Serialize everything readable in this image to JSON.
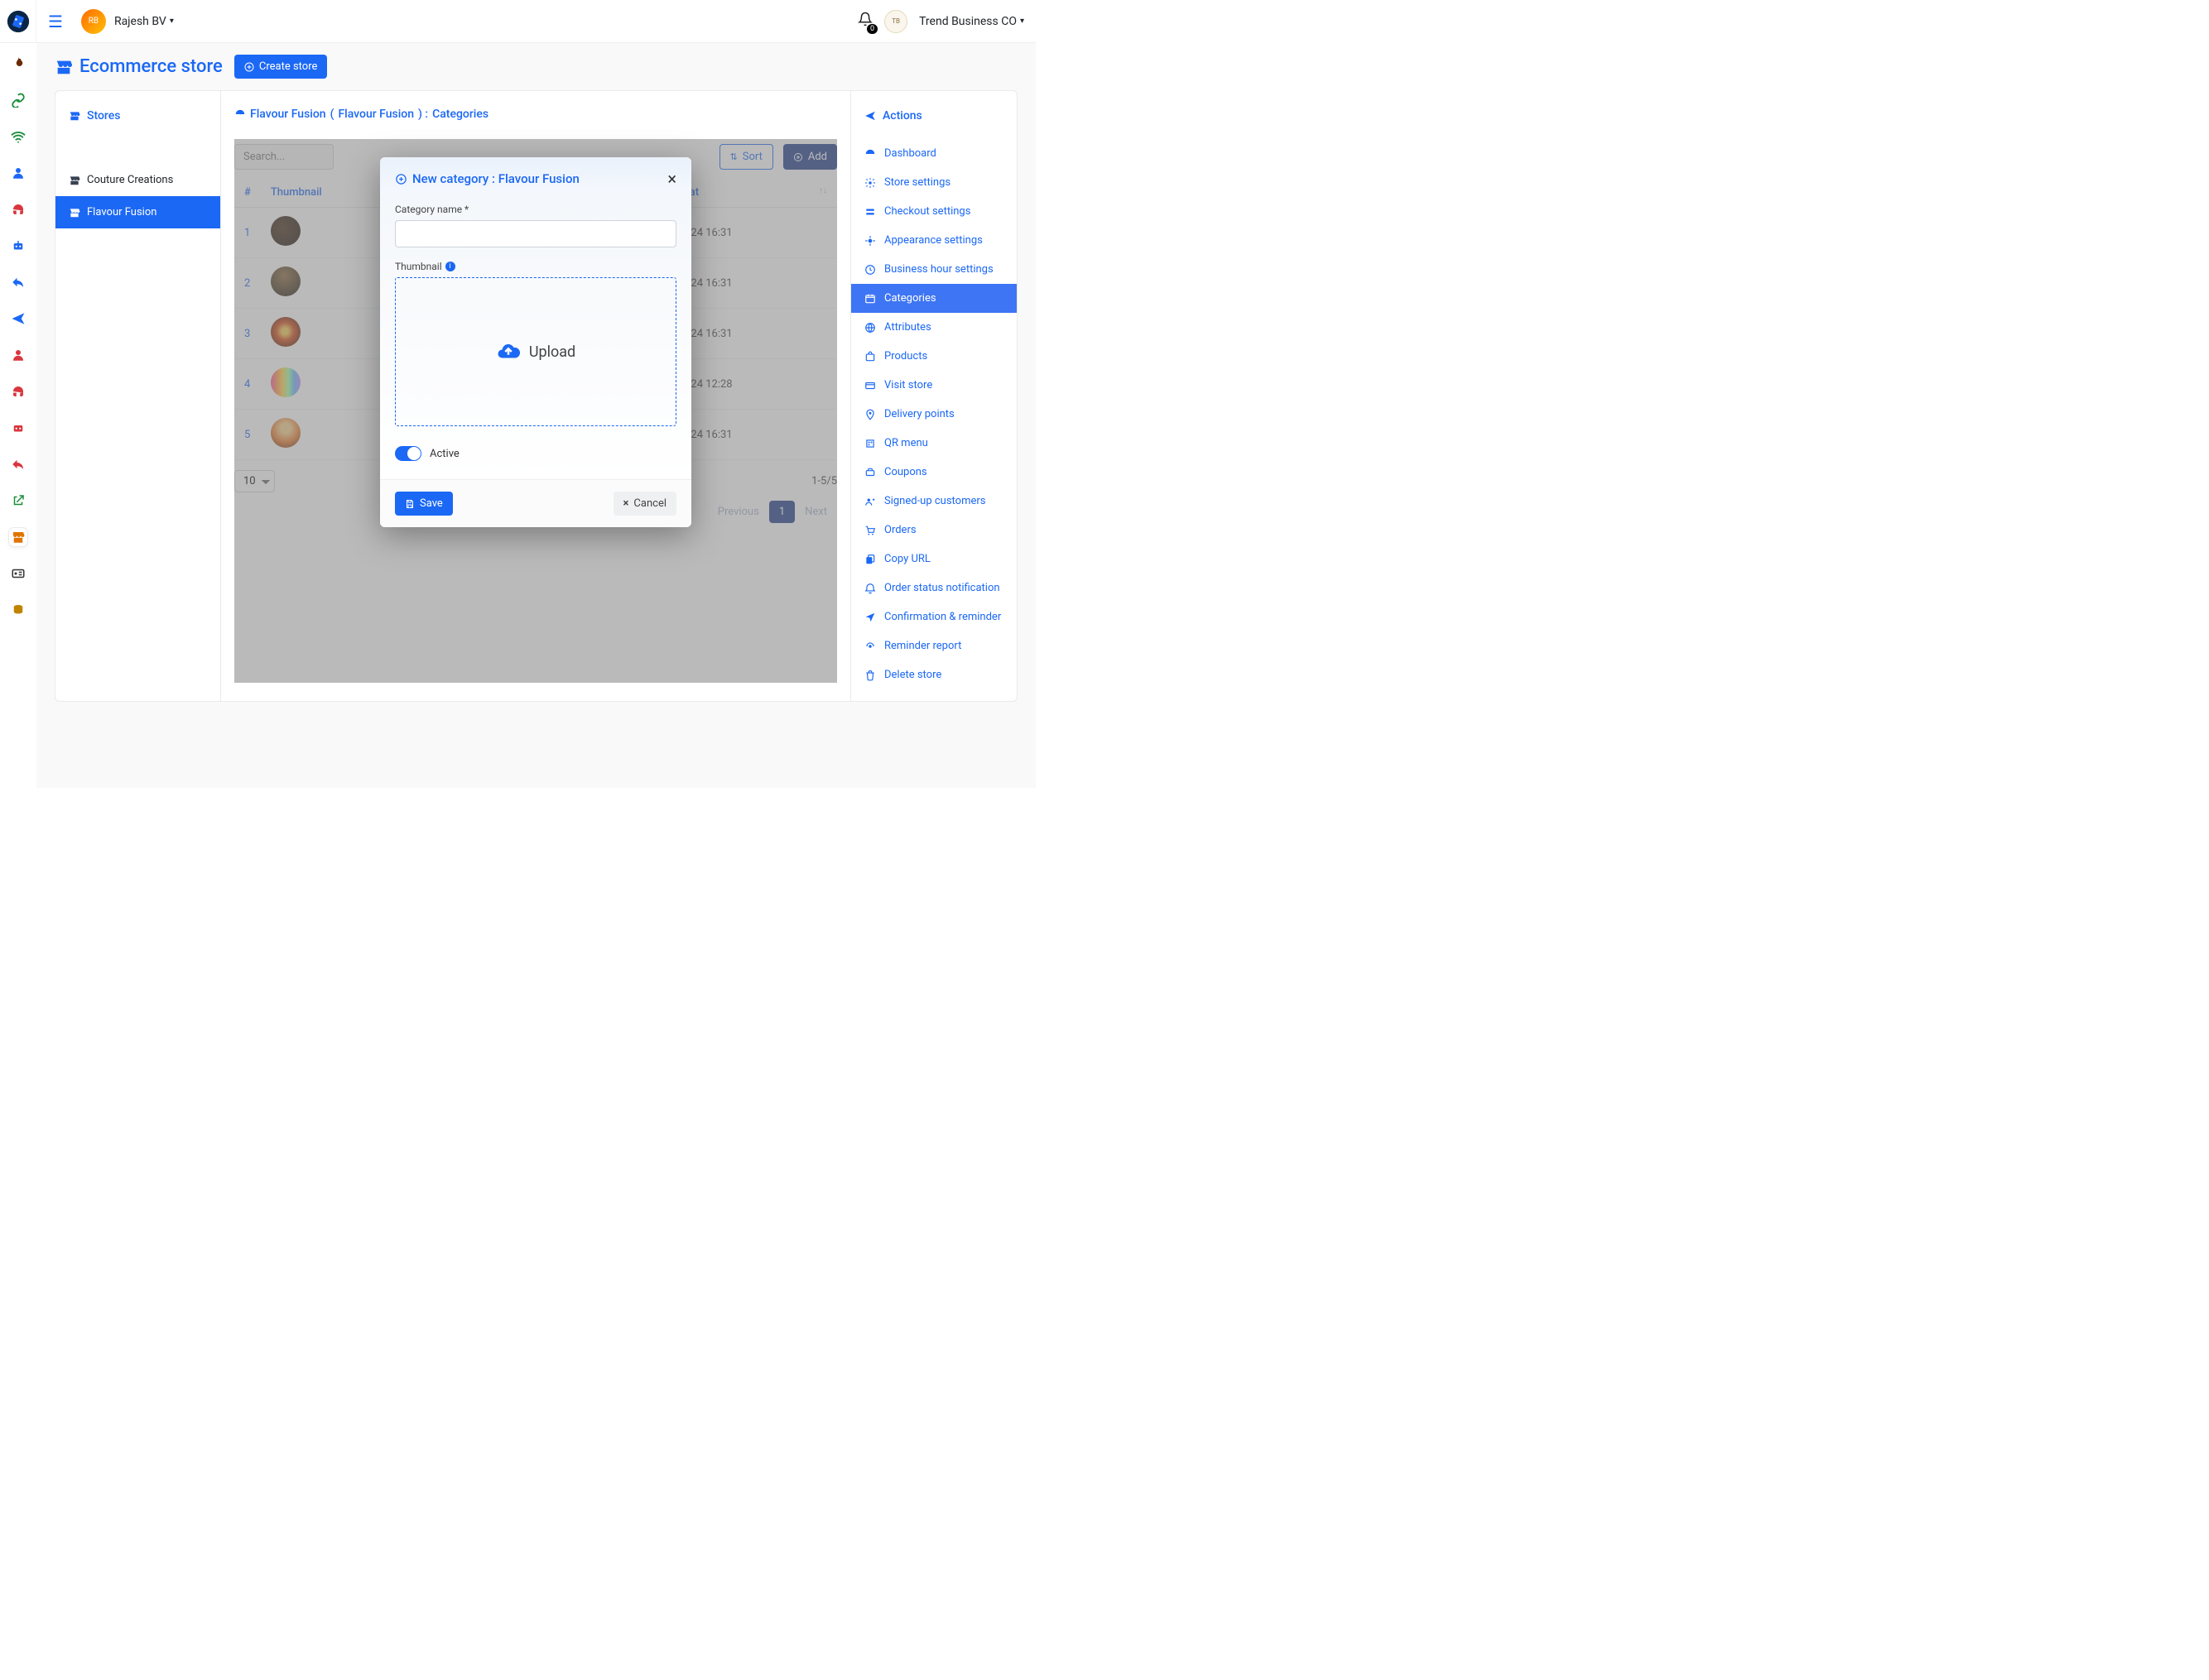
{
  "top": {
    "user_name": "Rajesh BV",
    "notif_count": "0",
    "business_name": "Trend Business CO"
  },
  "page": {
    "title": "Ecommerce store",
    "create_store": "Create store"
  },
  "stores": {
    "heading": "Stores",
    "items": [
      {
        "name": "Couture Creations"
      },
      {
        "name": "Flavour Fusion"
      }
    ]
  },
  "breadcrumb": {
    "store": "Flavour Fusion",
    "store_alt": "Flavour Fusion",
    "section": "Categories"
  },
  "toolbar": {
    "search_placeholder": "Search...",
    "sort": "Sort",
    "add": "Add"
  },
  "columns": {
    "idx": "#",
    "thumb": "Thumbnail",
    "updated": "Updated at"
  },
  "rows": [
    {
      "idx": "1",
      "updated": "25th Feb 24 16:31"
    },
    {
      "idx": "2",
      "updated": "25th Feb 24 16:31"
    },
    {
      "idx": "3",
      "updated": "25th Feb 24 16:31"
    },
    {
      "idx": "4",
      "updated": "19th Feb 24 12:28"
    },
    {
      "idx": "5",
      "updated": "25th Feb 24 16:31"
    }
  ],
  "footer": {
    "page_size": "10",
    "results": "1-5/5",
    "prev": "Previous",
    "page1": "1",
    "next": "Next"
  },
  "actions": {
    "heading": "Actions",
    "items": [
      "Dashboard",
      "Store settings",
      "Checkout settings",
      "Appearance settings",
      "Business hour settings",
      "Categories",
      "Attributes",
      "Products",
      "Visit store",
      "Delivery points",
      "QR menu",
      "Coupons",
      "Signed-up customers",
      "Orders",
      "Copy URL",
      "Order status notification",
      "Confirmation & reminder",
      "Reminder report",
      "Delete store"
    ],
    "active_index": 5
  },
  "modal": {
    "title_prefix": "New category : ",
    "title_store": "Flavour Fusion",
    "label_name": "Category name *",
    "label_thumb": "Thumbnail",
    "upload": "Upload",
    "active": "Active",
    "save": "Save",
    "cancel": "Cancel"
  }
}
